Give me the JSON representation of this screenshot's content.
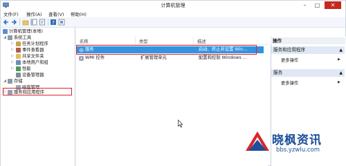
{
  "window": {
    "title": "计算机管理"
  },
  "menu": [
    "文件(F)",
    "操作(A)",
    "查看(V)",
    "帮助(H)"
  ],
  "tree": {
    "root": "计算机管理(本地)",
    "system_tools": "系统工具",
    "system_children": [
      "任务计划程序",
      "事件查看器",
      "共享文件夹",
      "本地用户和组",
      "性能",
      "设备管理器"
    ],
    "storage": "存储",
    "disk_management": "磁盘管理",
    "services_apps": "服务和应用程序"
  },
  "list": {
    "columns": [
      "名称",
      "类型",
      "描述"
    ],
    "rows": [
      {
        "name": "服务",
        "type": "",
        "desc": "启动、终止并设置 Win..."
      },
      {
        "name": "WMI 控件",
        "type": "扩展管理单元",
        "desc": "配置和控制 Windows ..."
      }
    ]
  },
  "actions": {
    "title": "操作",
    "sections": [
      {
        "label": "服务和应用程序",
        "more": "更多操作"
      },
      {
        "label": "服务",
        "more": "更多操作"
      }
    ]
  },
  "watermark": {
    "title": "晓枫资讯",
    "url": "bbs.yzwlu.com"
  },
  "colors": {
    "selection": "#3393df",
    "highlight_box": "#e0202a",
    "close": "#c7281d"
  }
}
